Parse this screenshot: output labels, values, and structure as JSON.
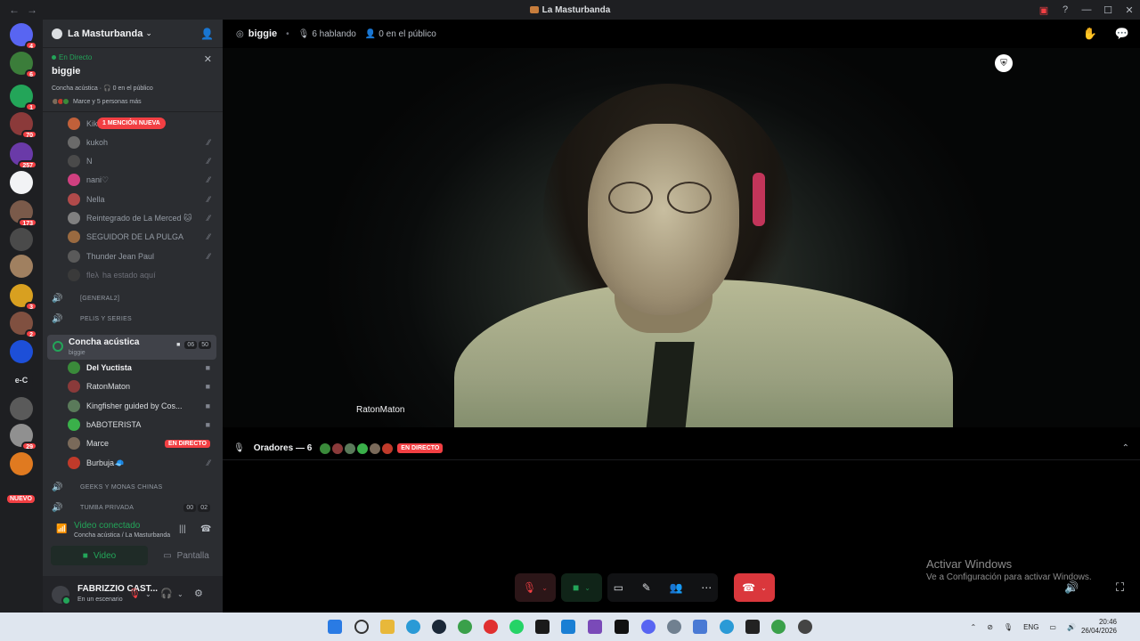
{
  "window": {
    "title": "La Masturbanda",
    "nav_back": "←",
    "nav_forward": "→"
  },
  "rail": {
    "items": [
      {
        "name": "direct-messages",
        "badge": "4",
        "color": "#5865f2"
      },
      {
        "name": "server-1",
        "badge": "6",
        "color": "#3b7d3a"
      },
      {
        "name": "server-2",
        "badge": "1",
        "color": "#23a559"
      },
      {
        "name": "server-3",
        "badge": "70",
        "color": "#8b3a3a"
      },
      {
        "name": "server-4",
        "badge": "257",
        "color": "#6a3aa8"
      },
      {
        "name": "server-5",
        "badge": "",
        "color": "#f2f3f5"
      },
      {
        "name": "server-6",
        "badge": "173",
        "color": "#7a5a4a"
      },
      {
        "name": "server-7",
        "badge": "",
        "color": "#4a4a4a"
      },
      {
        "name": "server-8",
        "badge": "",
        "color": "#a08060"
      },
      {
        "name": "server-9",
        "badge": "3",
        "color": "#d8a020"
      },
      {
        "name": "server-10",
        "badge": "2",
        "color": "#805040"
      },
      {
        "name": "server-11",
        "badge": "",
        "color": "#1d4fd8"
      },
      {
        "name": "server-12",
        "badge": "",
        "label": "e-C",
        "color": "#1e1f22"
      },
      {
        "name": "server-13",
        "badge": "",
        "color": "#5a5a5a"
      },
      {
        "name": "server-14",
        "badge": "29",
        "color": "#909090"
      },
      {
        "name": "server-15",
        "badge": "",
        "color": "#e07a20"
      }
    ],
    "nuevo_label": "NUEVO"
  },
  "guild": {
    "name": "La Masturbanda"
  },
  "stage_card": {
    "live_label": "En Directo",
    "stage_name": "biggie",
    "subtitle": "Concha acústica · 🎧 0 en el público",
    "more_text": "Marce y 5 personas más"
  },
  "mention_banner": "1 MENCIÓN NUEVA",
  "members_top": [
    {
      "name": "Kik",
      "color": "#c0603a"
    },
    {
      "name": "kukoh",
      "color": "#6a6a6a"
    },
    {
      "name": "N",
      "color": "#4a4a4a"
    },
    {
      "name": "nani♡",
      "color": "#d04080"
    },
    {
      "name": "Nella",
      "color": "#b04a4a"
    },
    {
      "name": "Reintegrado de La Merced 🐱",
      "color": "#808080"
    },
    {
      "name": "SEGUIDOR DE LA PULGA",
      "color": "#9a6a40"
    },
    {
      "name": "Thunder Jean Paul",
      "color": "#5a5a5a"
    },
    {
      "name": "fleλ",
      "extra": "ha estado aquí",
      "color": "#3a3a3a"
    }
  ],
  "voice_channels_top": [
    {
      "name": "[GENERAL2]"
    },
    {
      "name": "PELIS Y SERIES"
    }
  ],
  "active_channel": {
    "name": "Concha acústica",
    "topic": "biggie",
    "count_a": "06",
    "count_b": "50"
  },
  "stage_members": [
    {
      "name": "Del Yuctista",
      "color": "#3a8a3a"
    },
    {
      "name": "RatonMaton",
      "color": "#8a3a3a"
    },
    {
      "name": "Kingfisher guided by Cos...",
      "color": "#5a7a5a"
    },
    {
      "name": "bABOTERISTA",
      "color": "#3ab04a"
    },
    {
      "name": "Marce",
      "color": "#7a6a5a",
      "live": "EN DIRECTO"
    },
    {
      "name": "Burbuja🧢",
      "color": "#c03a2a"
    }
  ],
  "voice_channels_bottom": [
    {
      "name": "GEEKS Y MONAS CHINAS"
    },
    {
      "name": "TUMBA PRIVADA",
      "count_a": "00",
      "count_b": "02"
    }
  ],
  "voice_panel": {
    "status": "Video conectado",
    "location": "Concha acústica / La Masturbanda",
    "video_label": "Video",
    "screen_label": "Pantalla"
  },
  "user": {
    "name": "FABRIZZIO CAST...",
    "status": "En un escenario"
  },
  "stage_header": {
    "name": "biggie",
    "speaking": "6 hablando",
    "audience": "0 en el público"
  },
  "video": {
    "label": "RatonMaton"
  },
  "speakers_bar": {
    "title": "Oradores — 6",
    "live": "EN DIRECTO",
    "avatar_colors": [
      "#3a8a3a",
      "#8a3a3a",
      "#5a7a5a",
      "#3ab04a",
      "#7a6a5a",
      "#c03a2a"
    ]
  },
  "watermark": {
    "line1": "Activar Windows",
    "line2": "Ve a Configuración para activar Windows."
  },
  "taskbar": {
    "lang": "ENG",
    "time": "20:46",
    "date": "26/04/2026"
  }
}
